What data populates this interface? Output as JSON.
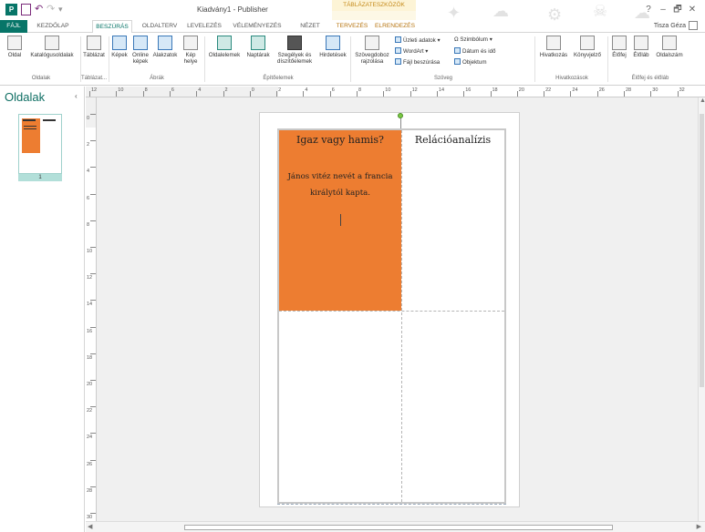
{
  "window": {
    "title": "Kiadvány1 - Publisher",
    "context_group": "TÁBLÁZATESZKÖZÖK",
    "app_icon": "P",
    "controls": [
      "?",
      "–",
      "🗗",
      "✕"
    ]
  },
  "tabs": [
    "FÁJL",
    "KEZDŐLAP",
    "BESZÚRÁS",
    "OLDALTERV",
    "LEVELEZÉS",
    "VÉLEMÉNYEZÉS",
    "NÉZET",
    "TERVEZÉS",
    "ELRENDEZÉS"
  ],
  "active_tab": "BESZÚRÁS",
  "user": "Tisza Géza",
  "ribbon": {
    "oldal": "Oldal",
    "katalogus": "Katalógusoldalak",
    "tablazat": "Táblázat",
    "kepek": "Képek",
    "online_kepek": "Online képek",
    "alakzatok": "Alakzatok",
    "kep_helye": "Kép helye",
    "oldalelemek": "Oldalelemek",
    "naptarak": "Naptárak",
    "szegelyek": "Szegélyek és díszítőelemek",
    "hirdetesek": "Hirdetések",
    "szovegdoboz": "Szövegdoboz rajzolása",
    "uzleti_adatok": "Üzleti adatok",
    "wordart": "WordArt",
    "fajl_beszurasa": "Fájl beszúrása",
    "szimbolum": "Szimbólum",
    "datum": "Dátum és idő",
    "objektum": "Objektum",
    "hivatkozas": "Hivatkozás",
    "konyvjelzo": "Könyvjelző",
    "elofej": "Élőfej",
    "eloláb": "Élőláb",
    "oldalszam": "Oldalszám",
    "groups": [
      "Oldalak",
      "Táblázat...",
      "Ábrák",
      "Építőelemek",
      "Szöveg",
      "Hivatkozások",
      "Élőfej és élőláb"
    ]
  },
  "pane": {
    "title": "Oldalak",
    "page_number": "1"
  },
  "rulers": {
    "h": [
      "12",
      "10",
      "8",
      "6",
      "4",
      "2",
      "0",
      "2",
      "4",
      "6",
      "8",
      "10",
      "12",
      "14",
      "16",
      "18",
      "20",
      "22",
      "24",
      "26",
      "28",
      "30",
      "32"
    ],
    "v": [
      "0",
      "2",
      "4",
      "6",
      "8",
      "10",
      "12",
      "14",
      "16",
      "18",
      "20",
      "22",
      "24",
      "26",
      "28",
      "30"
    ]
  },
  "document": {
    "cell_1_title": "Igaz vagy hamis?",
    "cell_1_body": "János vitéz nevét a francia királytól kapta.",
    "cell_2_title": "Relációanalízis",
    "cell_1_color": "#ed7d31"
  }
}
